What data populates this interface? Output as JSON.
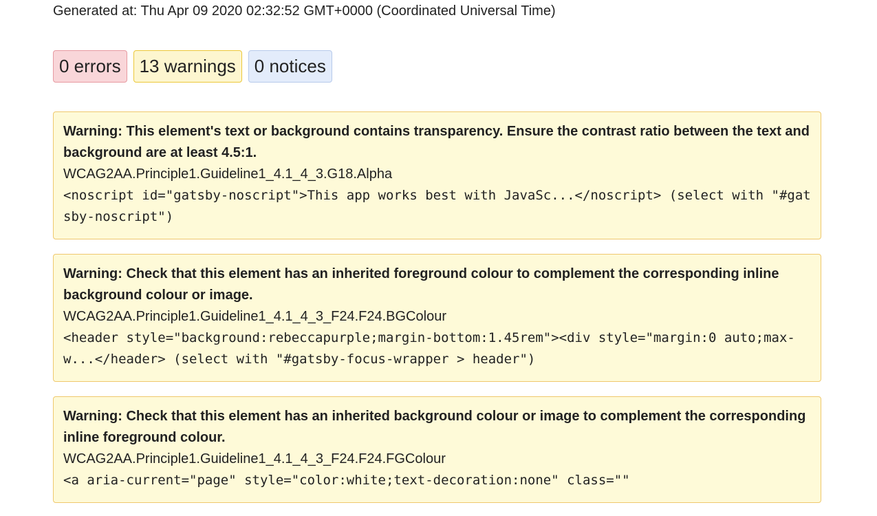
{
  "report": {
    "generated_label": "Generated at: Thu Apr 09 2020 02:32:52 GMT+0000 (Coordinated Universal Time)"
  },
  "counts": {
    "errors": "0 errors",
    "warnings": "13 warnings",
    "notices": "0 notices"
  },
  "colors": {
    "error_bg": "#f9d6d9",
    "warning_bg": "#fdf6cf",
    "notice_bg": "#e3ecfb",
    "issue_bg": "#fefad8",
    "issue_border": "#efc86d"
  },
  "issues": [
    {
      "title": "Warning: This element's text or background contains transparency. Ensure the contrast ratio between the text and background are at least 4.5:1.",
      "code": "WCAG2AA.Principle1.Guideline1_4.1_4_3.G18.Alpha",
      "context": "<noscript id=\"gatsby-noscript\">This app works best with JavaSc...</noscript> (select with \"#gatsby-noscript\")"
    },
    {
      "title": "Warning: Check that this element has an inherited foreground colour to complement the corresponding inline background colour or image.",
      "code": "WCAG2AA.Principle1.Guideline1_4.1_4_3_F24.F24.BGColour",
      "context": "<header style=\"background:rebeccapurple;margin-bottom:1.45rem\"><div style=\"margin:0 auto;max-w...</header> (select with \"#gatsby-focus-wrapper > header\")"
    },
    {
      "title": "Warning: Check that this element has an inherited background colour or image to complement the corresponding inline foreground colour.",
      "code": "WCAG2AA.Principle1.Guideline1_4.1_4_3_F24.F24.FGColour",
      "context": "<a aria-current=\"page\" style=\"color:white;text-decoration:none\" class=\"\""
    }
  ]
}
